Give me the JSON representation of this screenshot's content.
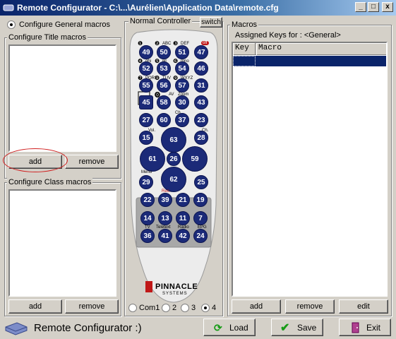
{
  "window": {
    "title": "Remote Configurator - C:\\...\\Aurélien\\Application Data\\remote.cfg",
    "minimize": "_",
    "maximize": "□",
    "close": "x"
  },
  "left": {
    "general_radio_label": "Configure General macros",
    "title_group_label": "Configure Title macros",
    "class_group_label": "Configure Class macros",
    "add_label": "add",
    "remove_label": "remove"
  },
  "controller": {
    "group_label": "Normal Controller",
    "switch_label": "switch",
    "brand": "PINNACLE",
    "brand_sub": "SYSTEMS",
    "ports": [
      "Com1",
      "2",
      "3",
      "4"
    ],
    "selected_port": "4",
    "small_labels": {
      "l1": "ABC",
      "l2": "DEF",
      "l3": "off",
      "l4": "ghi",
      "l5": "jkl",
      "l6": "mno",
      "l7": "PQRS",
      "l8": "TUV",
      "l9": "WXYZ",
      "av": "AV",
      "zoom": "Zoom",
      "ch": "Ch.",
      "vol": "Vol.",
      "ch2": "Ch.",
      "menu": "Menu",
      "rec": "Rec.",
      "teletext": "Teletext",
      "radio": "Radio",
      "tv": "TV",
      "epg": "EPG"
    },
    "keys": {
      "k49": "49",
      "k50": "50",
      "k51": "51",
      "k47": "47",
      "k52": "52",
      "k53": "53",
      "k54": "54",
      "k46": "46",
      "k55": "55",
      "k56": "56",
      "k57": "57",
      "k31": "31",
      "k45": "45",
      "k58": "58",
      "k30": "30",
      "k43": "43",
      "k27": "27",
      "k60": "60",
      "k37": "37",
      "k23": "23",
      "k15": "15",
      "k28": "28",
      "k63": "63",
      "k61": "61",
      "k26": "26",
      "k59": "59",
      "k62": "62",
      "k29": "29",
      "k25": "25",
      "k22": "22",
      "k39": "39",
      "k21": "21",
      "k19": "19",
      "k14": "14",
      "k13": "13",
      "k11": "11",
      "k7": "7",
      "k36": "36",
      "k41": "41",
      "k42": "42",
      "k24": "24"
    }
  },
  "macros": {
    "group_label": "Macros",
    "assigned_label": "Assigned Keys for : <General>",
    "columns": [
      "Key",
      "Macro"
    ],
    "add_label": "add",
    "remove_label": "remove",
    "edit_label": "edit"
  },
  "bottom": {
    "app_label": "Remote Configurator :)",
    "load_label": "Load",
    "save_label": "Save",
    "exit_label": "Exit"
  },
  "colors": {
    "titlebar_start": "#0a246a",
    "key_blue": "#1b2a78",
    "selected_row": "#0a246a"
  }
}
